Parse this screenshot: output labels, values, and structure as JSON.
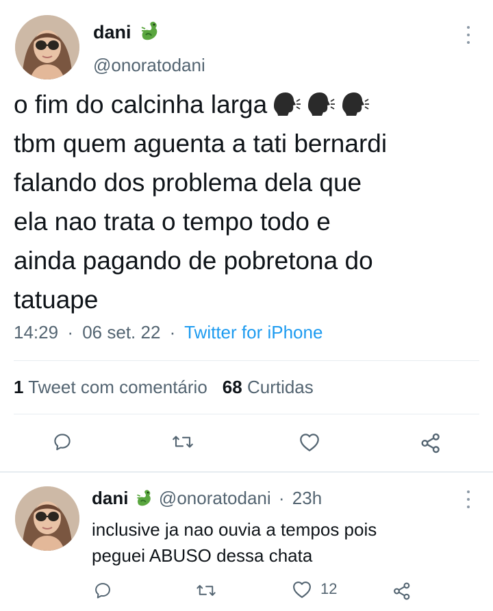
{
  "main": {
    "name": "dani",
    "handle": "@onoratodani",
    "lines": [
      "o fim do calcinha larga",
      "tbm quem aguenta a tati bernardi",
      "falando dos problema dela que",
      "ela nao trata o tempo todo e",
      "ainda pagando de pobretona do",
      "tatuape"
    ],
    "emoji": [
      "speaking-head-emoji",
      "speaking-head-emoji",
      "speaking-head-emoji"
    ],
    "time": "14:29",
    "date": "06 set. 22",
    "sep": "·",
    "source": "Twitter for iPhone",
    "stats": {
      "quotes_count": "1",
      "quotes_label": "Tweet com comentário",
      "likes_count": "68",
      "likes_label": "Curtidas"
    },
    "actions": [
      "reply-icon",
      "retweet-icon",
      "like-icon",
      "share-icon"
    ]
  },
  "reply": {
    "name": "dani",
    "handle": "@onoratodani",
    "sep": "·",
    "time_ago": "23h",
    "lines": [
      "inclusive ja nao ouvia a tempos pois",
      "peguei ABUSO dessa chata"
    ],
    "like_count": "12"
  },
  "colors": {
    "text": "#0f1419",
    "secondary": "#536471",
    "link": "#1d9bf0",
    "divider": "#e6ecf0",
    "dragon": "#5aa63f"
  }
}
